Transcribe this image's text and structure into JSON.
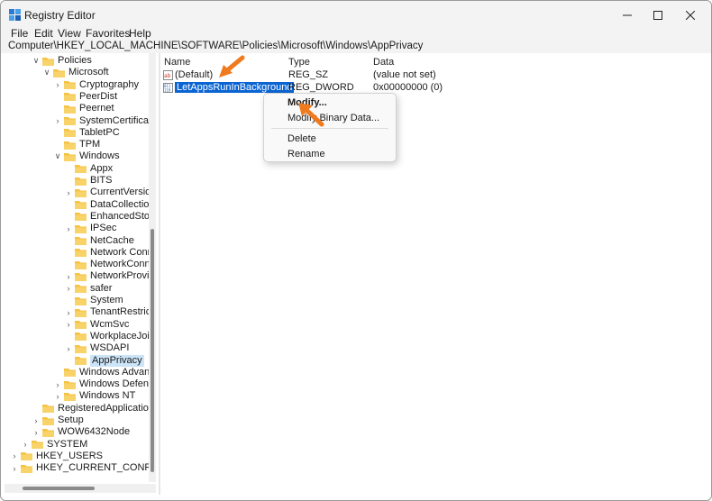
{
  "window": {
    "title": "Registry Editor",
    "controls": [
      "minimize",
      "maximize",
      "close"
    ]
  },
  "menu": [
    "File",
    "Edit",
    "View",
    "Favorites",
    "Help"
  ],
  "address": "Computer\\HKEY_LOCAL_MACHINE\\SOFTWARE\\Policies\\Microsoft\\Windows\\AppPrivacy",
  "tree": [
    {
      "label": "Policies",
      "expanded": true
    },
    {
      "label": "Microsoft",
      "expanded": true
    },
    {
      "label": "Cryptography",
      "expanded": false
    },
    {
      "label": "PeerDist",
      "expanded": null
    },
    {
      "label": "Peernet",
      "expanded": null
    },
    {
      "label": "SystemCertificates",
      "expanded": false
    },
    {
      "label": "TabletPC",
      "expanded": null
    },
    {
      "label": "TPM",
      "expanded": null
    },
    {
      "label": "Windows",
      "expanded": true
    },
    {
      "label": "Appx",
      "expanded": null
    },
    {
      "label": "BITS",
      "expanded": null
    },
    {
      "label": "CurrentVersion",
      "expanded": false
    },
    {
      "label": "DataCollection",
      "expanded": null
    },
    {
      "label": "EnhancedStorag",
      "expanded": null
    },
    {
      "label": "IPSec",
      "expanded": false
    },
    {
      "label": "NetCache",
      "expanded": null
    },
    {
      "label": "Network Conne",
      "expanded": null
    },
    {
      "label": "NetworkConnec",
      "expanded": null
    },
    {
      "label": "NetworkProvide",
      "expanded": false
    },
    {
      "label": "safer",
      "expanded": false
    },
    {
      "label": "System",
      "expanded": null
    },
    {
      "label": "TenantRestrictic",
      "expanded": false
    },
    {
      "label": "WcmSvc",
      "expanded": false
    },
    {
      "label": "WorkplaceJoin",
      "expanded": null
    },
    {
      "label": "WSDAPI",
      "expanded": false
    },
    {
      "label": "AppPrivacy",
      "expanded": null,
      "selected": true
    },
    {
      "label": "Windows Advance",
      "expanded": null
    },
    {
      "label": "Windows Defende",
      "expanded": false
    },
    {
      "label": "Windows NT",
      "expanded": false
    },
    {
      "label": "RegisteredApplications",
      "expanded": null
    },
    {
      "label": "Setup",
      "expanded": false
    },
    {
      "label": "WOW6432Node",
      "expanded": false
    },
    {
      "label": "SYSTEM",
      "expanded": false
    },
    {
      "label": "HKEY_USERS",
      "expanded": false
    },
    {
      "label": "HKEY_CURRENT_CONFIG",
      "expanded": false
    }
  ],
  "columns": {
    "name": "Name",
    "type": "Type",
    "data": "Data"
  },
  "values": [
    {
      "name": "(Default)",
      "type": "REG_SZ",
      "data": "(value not set)",
      "icon": "string-value-icon"
    },
    {
      "name": "LetAppsRunInBackground",
      "type": "REG_DWORD",
      "data": "0x00000000 (0)",
      "icon": "binary-value-icon",
      "selected": true
    }
  ],
  "context_menu": {
    "modify": "Modify...",
    "modify_binary": "Modify Binary Data...",
    "delete": "Delete",
    "rename": "Rename"
  },
  "colors": {
    "accent": "#0a64d2",
    "folder": "#f5c242",
    "arrow": "#f07a1e"
  }
}
